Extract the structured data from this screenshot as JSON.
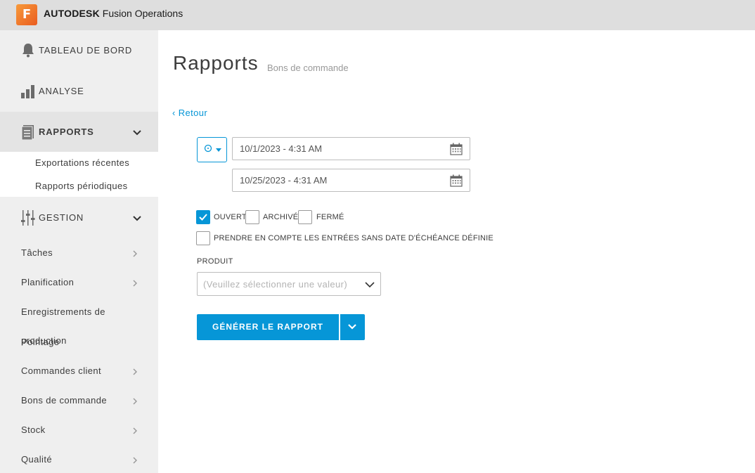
{
  "header": {
    "logo_letter": "F",
    "brand_bold": "AUTODESK",
    "brand_rest": "Fusion Operations"
  },
  "sidebar": {
    "main_items": [
      {
        "label": "TABLEAU DE BORD",
        "icon": "bell-icon"
      },
      {
        "label": "ANALYSE",
        "icon": "bar-chart-icon"
      },
      {
        "label": "RAPPORTS",
        "icon": "document-icon"
      },
      {
        "label": "GESTION",
        "icon": "sliders-icon"
      }
    ],
    "rapports_sub": [
      "Exportations récentes",
      "Rapports périodiques"
    ],
    "gestion_sub": [
      "Tâches",
      "Planification",
      "Enregistrements de",
      "production",
      "Pointage",
      "Commandes client",
      "Bons de commande",
      "Stock",
      "Qualité"
    ]
  },
  "main": {
    "title": "Rapports",
    "subtitle": "Bons de commande",
    "back_label": "‹ Retour",
    "date_from": "10/1/2023 - 4:31 AM",
    "date_to": "10/25/2023 - 4:31 AM",
    "checkboxes": {
      "ouvert": {
        "label": "OUVERT",
        "checked": true
      },
      "archive": {
        "label": "ARCHIVÉ",
        "checked": false
      },
      "ferme": {
        "label": "FERMÉ",
        "checked": false
      },
      "sans_date": {
        "label": "PRENDRE EN COMPTE LES ENTRÉES SANS DATE D'ÉCHÉANCE DÉFINIE",
        "checked": false
      }
    },
    "produit_label": "PRODUIT",
    "produit_placeholder": "(Veuillez sélectionner une valeur)",
    "generate_label": "GÉNÉRER LE RAPPORT"
  },
  "colors": {
    "accent": "#0696d7",
    "sidebar_bg": "#efefef",
    "topbar_bg": "#dedede",
    "logo": "#f08a30"
  }
}
